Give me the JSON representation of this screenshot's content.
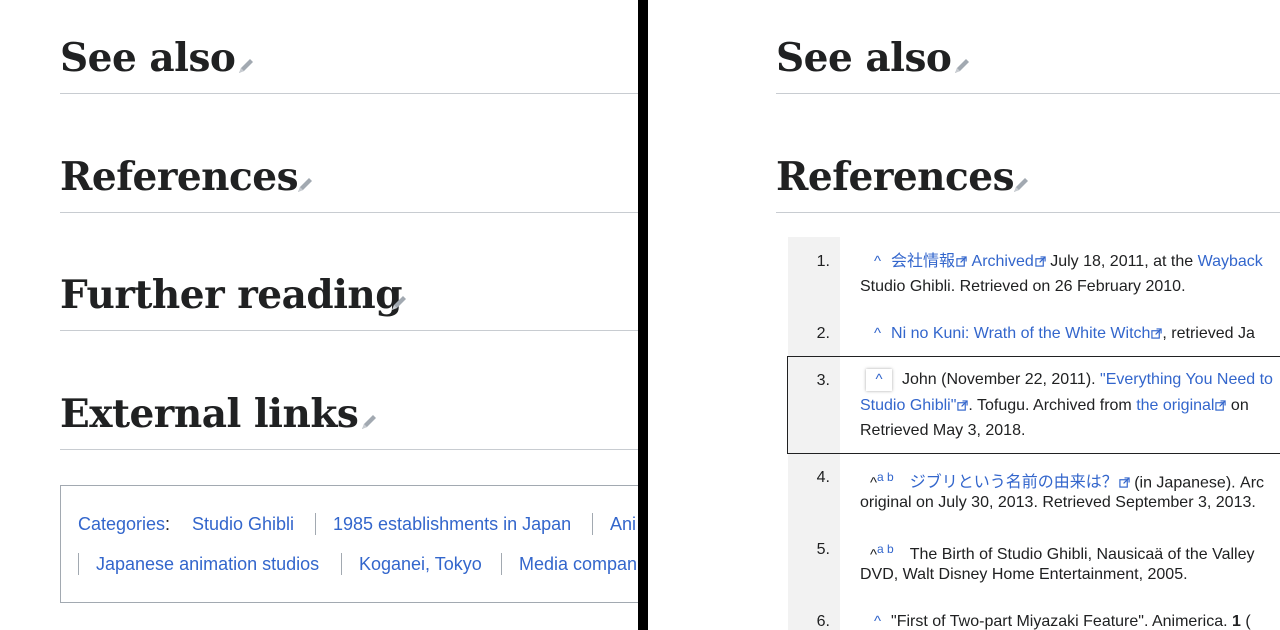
{
  "left": {
    "headings": [
      "See also",
      "References",
      "Further reading",
      "External links"
    ],
    "categories": {
      "label": "Categories",
      "colon": ":",
      "row1": [
        "Studio Ghibli",
        "1985 establishments in Japan",
        "Ani"
      ],
      "row2": [
        "Japanese animation studios",
        "Koganei, Tokyo",
        "Media compan"
      ]
    }
  },
  "right": {
    "headings": [
      "See also",
      "References"
    ],
    "refs": [
      {
        "num": "1.",
        "caret": "^",
        "link1": "会社情報",
        "link2": "Archived",
        "text1": " July 18, 2011, at the ",
        "link3": "Wayback",
        "line2": "Studio Ghibli. Retrieved on 26 February 2010."
      },
      {
        "num": "2.",
        "caret": "^",
        "link1": "Ni no Kuni: Wrath of the White Witch",
        "text1": ", retrieved Ja"
      },
      {
        "num": "3.",
        "caret": "^",
        "text1": "John (November 22, 2011). ",
        "link1": "\"Everything You Need to",
        "link2": "Studio Ghibli\"",
        "text2": ". Tofugu. Archived from ",
        "link3": "the original",
        "text3": " on",
        "line3": "Retrieved May 3, 2018."
      },
      {
        "num": "4.",
        "caret": "^",
        "ab": "a b",
        "link1": "ジブリという名前の由来は？",
        "text1": " (in Japanese). Arc",
        "line2": "original on July 30, 2013. Retrieved September 3, 2013."
      },
      {
        "num": "5.",
        "caret": "^",
        "ab": "a b",
        "text1": "The Birth of Studio Ghibli, Nausicaä of the Valley",
        "line2": "DVD, Walt Disney Home Entertainment, 2005."
      },
      {
        "num": "6.",
        "caret": "^",
        "text1": "\"First of Two-part Miyazaki Feature\". Animerica. ",
        "bold1": "1",
        "text2": " ("
      }
    ]
  },
  "colors": {
    "link": "#3366cc",
    "text": "#202122",
    "divider": "#000000",
    "rule": "#c8ccd1"
  }
}
